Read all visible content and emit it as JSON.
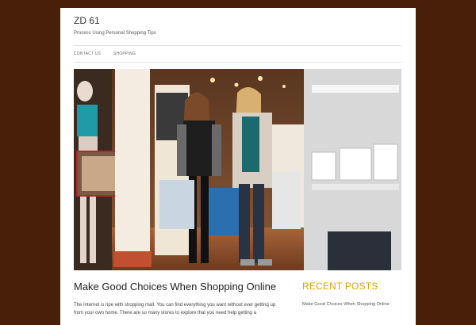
{
  "site": {
    "title": "ZD 61",
    "description": "Process Using Personal Shopping Tips"
  },
  "nav": {
    "items": [
      {
        "label": "CONTACT US"
      },
      {
        "label": "SHOPPING"
      }
    ]
  },
  "post": {
    "title": "Make Good Choices When Shopping Online",
    "excerpt": "The Internet is ripe with shopping mall. You can find everything you want without ever getting up from your own home. There are so many stores to explore that you need help getting a"
  },
  "sidebar": {
    "widget_title": "RECENT POSTS",
    "recent_posts": [
      {
        "label": "Make Good Choices When Shopping Online"
      }
    ]
  },
  "colors": {
    "background": "#4a1f0a",
    "accent": "#e0a600"
  }
}
